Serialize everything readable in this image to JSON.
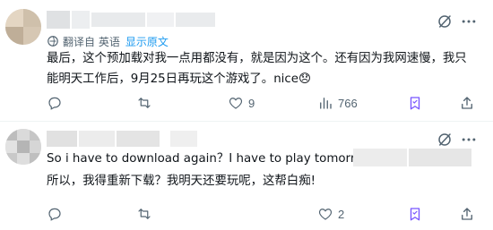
{
  "colors": {
    "accent": "#1d9bf0",
    "secondary_text": "#536471",
    "primary_text": "#0f1419",
    "bookmark_accent": "#7856ff"
  },
  "posts": [
    {
      "translation": {
        "label": "翻译自 英语",
        "show_original": "显示原文"
      },
      "text": "最后，这个预加载对我一点用都没有，就是因为这个。还有因为我网速慢，我只能明天工作后，9月25日再玩这个游戏了。nice😞",
      "actions": {
        "reply_count": "",
        "repost_count": "",
        "like_count": "9",
        "view_count": "766"
      }
    },
    {
      "text_en": "So i have to download again？I have to play tomorrow",
      "text_zh": "所以，我得重新下载？我明天还要玩呢，这帮白痴!",
      "actions": {
        "reply_count": "",
        "repost_count": "",
        "like_count": "2",
        "view_count": ""
      }
    }
  ],
  "icons": {
    "grok": "grok-slash-icon",
    "more": "more-horizontal-icon",
    "reply": "reply-bubble-icon",
    "repost": "repost-arrows-icon",
    "like": "heart-icon",
    "views": "views-bar-chart-icon",
    "bookmark": "bookmark-icon",
    "share": "share-upload-icon",
    "translate": "translate-globe-icon"
  }
}
